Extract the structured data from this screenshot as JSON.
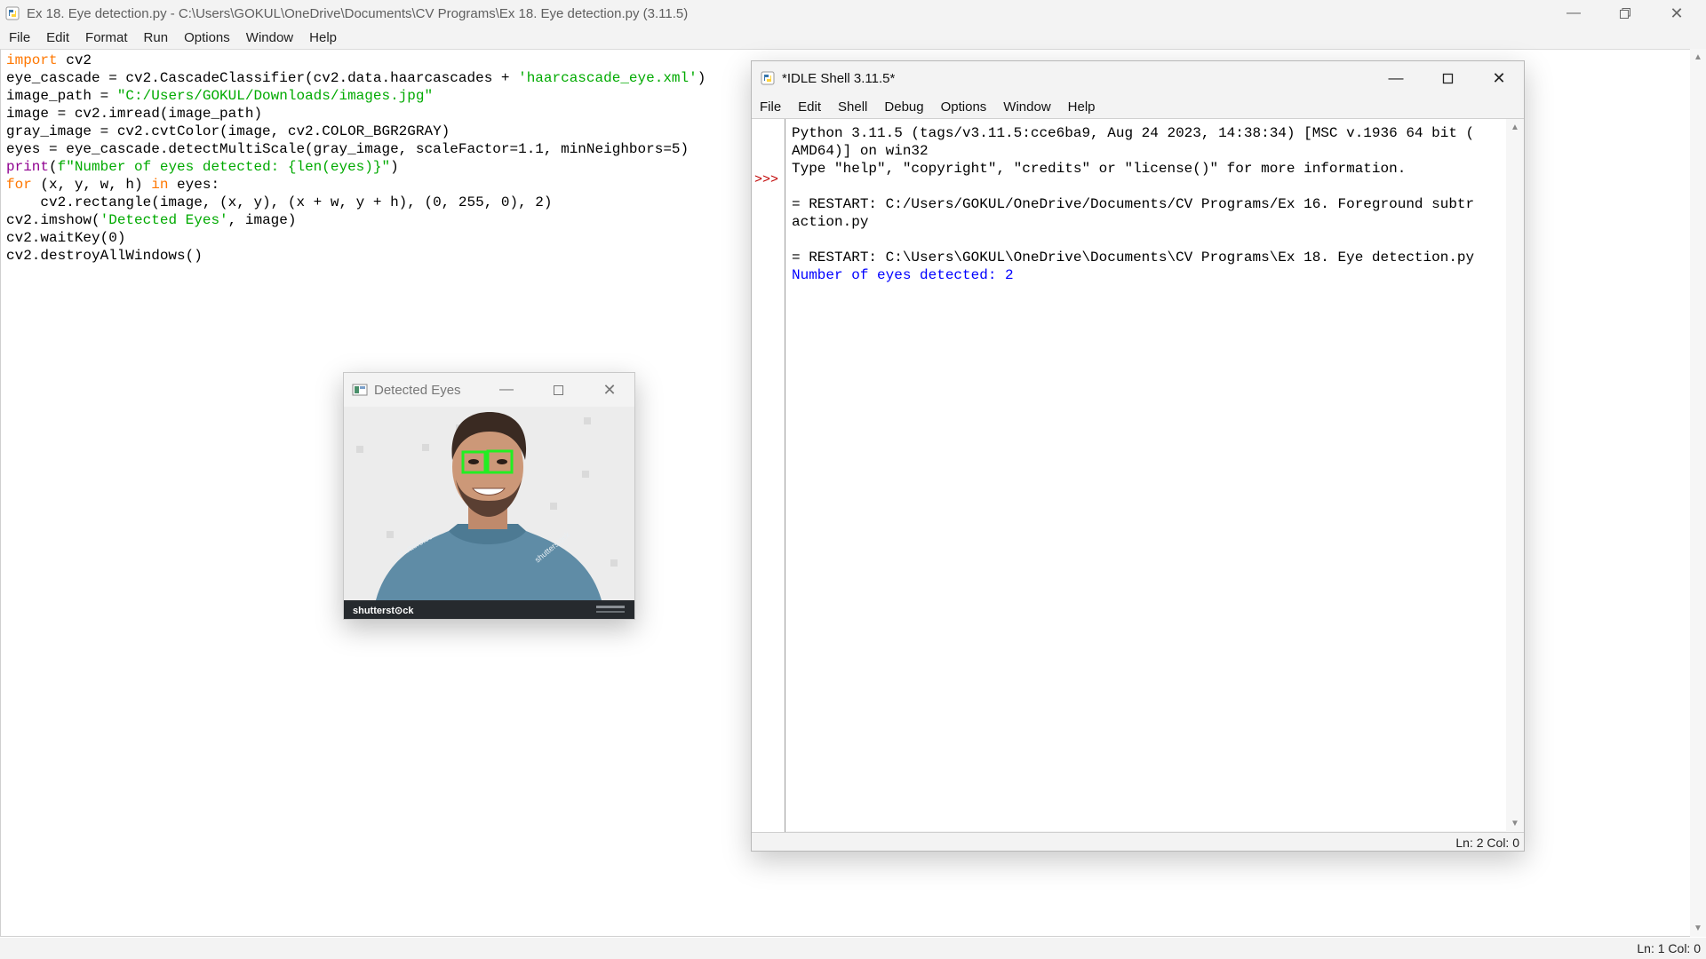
{
  "editor": {
    "title": "Ex 18. Eye detection.py - C:\\Users\\GOKUL\\OneDrive\\Documents\\CV Programs\\Ex 18. Eye detection.py (3.11.5)",
    "menu": [
      "File",
      "Edit",
      "Format",
      "Run",
      "Options",
      "Window",
      "Help"
    ],
    "code": {
      "l1": {
        "kw": "import",
        "rest": " cv2"
      },
      "l2": {
        "pre": "eye_cascade = cv2.CascadeClassifier(cv2.data.haarcascades + ",
        "str": "'haarcascade_eye.xml'",
        "post": ")"
      },
      "l3": {
        "pre": "image_path = ",
        "str": "\"C:/Users/GOKUL/Downloads/images.jpg\""
      },
      "l4": "image = cv2.imread(image_path)",
      "l5": "gray_image = cv2.cvtColor(image, cv2.COLOR_BGR2GRAY)",
      "l6": "eyes = eye_cascade.detectMultiScale(gray_image, scaleFactor=1.1, minNeighbors=5)",
      "l7": {
        "bi": "print",
        "pre": "(",
        "str": "f\"Number of eyes detected: {len(eyes)}\"",
        "post": ")"
      },
      "l8": {
        "kw1": "for",
        "mid": " (x, y, w, h) ",
        "kw2": "in",
        "post": " eyes:"
      },
      "l9": "    cv2.rectangle(image, (x, y), (x + w, y + h), (0, 255, 0), 2)",
      "l10": {
        "pre": "cv2.imshow(",
        "str": "'Detected Eyes'",
        "post": ", image)"
      },
      "l11": "cv2.waitKey(0)",
      "l12": "cv2.destroyAllWindows()"
    },
    "status": "Ln: 1   Col: 0"
  },
  "shell": {
    "title": "*IDLE Shell 3.11.5*",
    "menu": [
      "File",
      "Edit",
      "Shell",
      "Debug",
      "Options",
      "Window",
      "Help"
    ],
    "prompt": ">>>",
    "lines": {
      "l1": "Python 3.11.5 (tags/v3.11.5:cce6ba9, Aug 24 2023, 14:38:34) [MSC v.1936 64 bit (",
      "l2": "AMD64)] on win32",
      "l3": "Type \"help\", \"copyright\", \"credits\" or \"license()\" for more information.",
      "l4": "",
      "l5": "= RESTART: C:/Users/GOKUL/OneDrive/Documents/CV Programs/Ex 16. Foreground subtr",
      "l6": "action.py",
      "l7": "",
      "l8": "= RESTART: C:\\Users\\GOKUL\\OneDrive\\Documents\\CV Programs\\Ex 18. Eye detection.py",
      "l9": "Number of eyes detected: 2"
    },
    "status": "Ln: 2   Col: 0"
  },
  "eyes_window": {
    "title": "Detected Eyes",
    "watermark": "shutterstock",
    "watermark_short": "shutterst⊙ck"
  },
  "colors": {
    "keyword": "#ff7700",
    "string": "#00aa00",
    "builtin": "#900090",
    "stdout": "#0000ff",
    "prompt": "#c00000",
    "detection_box": "#22ee22"
  },
  "icons": [
    "python-file-icon",
    "minimize-icon",
    "maximize-icon",
    "restore-icon",
    "close-icon",
    "scroll-up-arrow-icon",
    "scroll-down-arrow-icon",
    "opencv-window-icon"
  ]
}
